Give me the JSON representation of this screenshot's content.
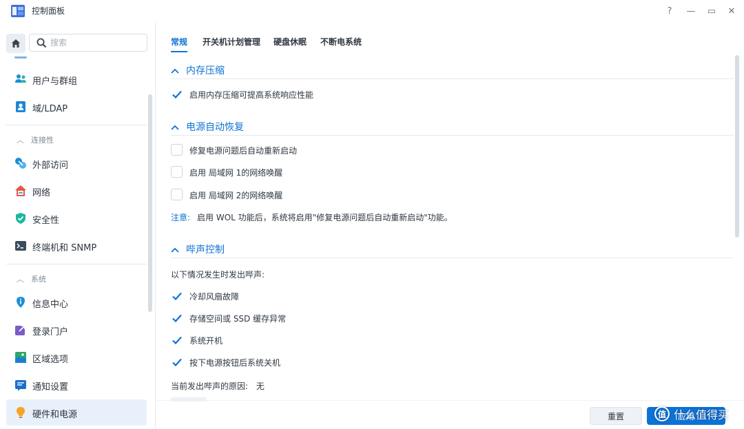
{
  "window": {
    "title": "控制面板",
    "help_glyph": "?",
    "minimize_glyph": "—",
    "maximize_glyph": "▭",
    "close_glyph": "✕"
  },
  "sidebar": {
    "search_placeholder": "搜索",
    "items": [
      {
        "label": "用户与群组",
        "icon": "users-icon"
      },
      {
        "label": "域/LDAP",
        "icon": "domain-ldap-icon"
      },
      {
        "label": "外部访问",
        "icon": "external-access-icon"
      },
      {
        "label": "网络",
        "icon": "network-icon"
      },
      {
        "label": "安全性",
        "icon": "security-shield-icon"
      },
      {
        "label": "终端机和 SNMP",
        "icon": "terminal-icon"
      },
      {
        "label": "信息中心",
        "icon": "info-center-icon"
      },
      {
        "label": "登录门户",
        "icon": "login-portal-icon"
      },
      {
        "label": "区域选项",
        "icon": "regional-options-icon"
      },
      {
        "label": "通知设置",
        "icon": "notification-icon"
      },
      {
        "label": "硬件和电源",
        "icon": "hardware-power-icon",
        "active": true
      }
    ],
    "groups": {
      "connectivity": "连接性",
      "system": "系统"
    }
  },
  "tabs": [
    {
      "label": "常规",
      "active": true
    },
    {
      "label": "开关机计划管理"
    },
    {
      "label": "硬盘休眠"
    },
    {
      "label": "不断电系统"
    }
  ],
  "sections": {
    "memory": {
      "title": "内存压缩",
      "options": [
        {
          "label": "启用内存压缩可提高系统响应性能",
          "checked": true
        }
      ]
    },
    "power_recovery": {
      "title": "电源自动恢复",
      "options": [
        {
          "label": "修复电源问题后自动重新启动",
          "checked": false
        },
        {
          "label": "启用 局域网 1的网络唤醒",
          "checked": false
        },
        {
          "label": "启用 局域网 2的网络唤醒",
          "checked": false
        }
      ],
      "note_prefix": "注意:",
      "note_text": "启用 WOL 功能后，系统将启用\"修复电源问题后自动重新启动\"功能。"
    },
    "beep": {
      "title": "哔声控制",
      "intro": "以下情况发生时发出哔声:",
      "options": [
        {
          "label": "冷却风扇故障",
          "checked": true
        },
        {
          "label": "存储空间或 SSD 缓存异常",
          "checked": true
        },
        {
          "label": "系统开机",
          "checked": true
        },
        {
          "label": "按下电源按钮后系统关机",
          "checked": true
        }
      ],
      "reason_label": "当前发出哔声的原因:",
      "reason_value": "无"
    }
  },
  "footer": {
    "reset_label": "重置",
    "apply_label": "应用"
  },
  "watermark": {
    "logo_text": "值",
    "text": "什么值得买"
  },
  "colors": {
    "accent": "#0d72d6",
    "active_bg": "#e8f1fb"
  }
}
